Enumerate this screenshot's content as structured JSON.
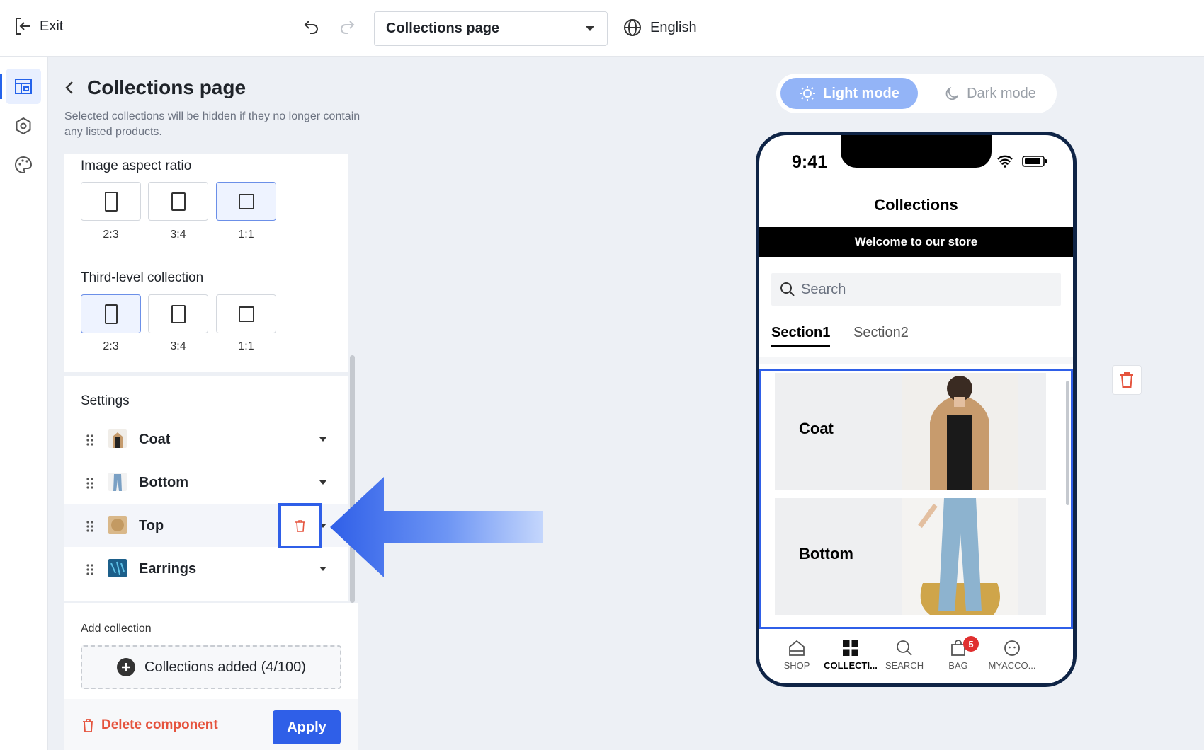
{
  "topbar": {
    "exit_label": "Exit",
    "page_select_value": "Collections page",
    "language": "English"
  },
  "panel": {
    "title": "Collections page",
    "description": "Selected collections will be hidden if they no longer contain any listed products.",
    "image_aspect": {
      "label": "Image aspect ratio",
      "options": [
        "2:3",
        "3:4",
        "1:1"
      ],
      "selected": "1:1"
    },
    "third_level": {
      "label": "Third-level collection",
      "options": [
        "2:3",
        "3:4",
        "1:1"
      ],
      "selected": "2:3"
    },
    "settings_label": "Settings",
    "collections": [
      {
        "name": "Coat"
      },
      {
        "name": "Bottom"
      },
      {
        "name": "Top"
      },
      {
        "name": "Earrings"
      }
    ],
    "add_collection_label": "Add collection",
    "collections_added": "Collections added (4/100)",
    "delete_component": "Delete component",
    "apply": "Apply"
  },
  "preview": {
    "light_mode": "Light mode",
    "dark_mode": "Dark mode",
    "time": "9:41",
    "title": "Collections",
    "banner": "Welcome to our store",
    "search_placeholder": "Search",
    "tabs": [
      "Section1",
      "Section2"
    ],
    "cards": [
      {
        "name": "Coat"
      },
      {
        "name": "Bottom"
      }
    ],
    "nav": [
      {
        "label": "SHOP"
      },
      {
        "label": "COLLECTI..."
      },
      {
        "label": "SEARCH"
      },
      {
        "label": "BAG",
        "badge": "5"
      },
      {
        "label": "MYACCO..."
      }
    ]
  },
  "colors": {
    "accent": "#2f5fe8",
    "danger": "#e5533d",
    "phone_frame": "#0f2446"
  }
}
